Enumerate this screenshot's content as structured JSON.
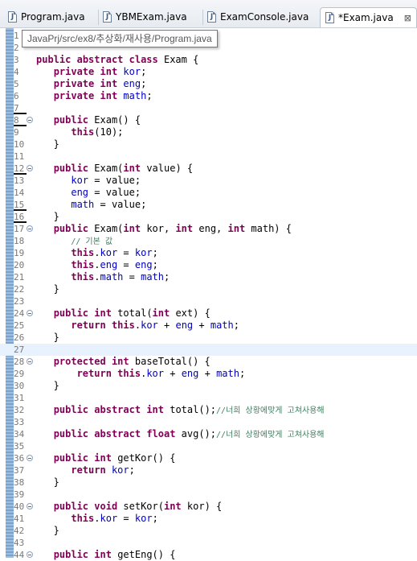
{
  "tabs": [
    {
      "label": "Program.java",
      "icon": "java-file-icon",
      "active": false
    },
    {
      "label": "YBMExam.java",
      "icon": "java-file-icon",
      "active": false
    },
    {
      "label": "ExamConsole.java",
      "icon": "java-file-icon",
      "active": false
    },
    {
      "label": "*Exam.java",
      "icon": "java-file-icon",
      "active": true,
      "close": "⊠"
    }
  ],
  "tooltip": {
    "text": "JavaPrj/src/ex8/추상화/재사용/Program.java"
  },
  "editor": {
    "current_line": 27,
    "lines": [
      {
        "n": "1",
        "t": ""
      },
      {
        "n": "2",
        "t": ""
      },
      {
        "n": "3",
        "t": "public abstract class Exam {"
      },
      {
        "n": "4",
        "t": "   private int kor;"
      },
      {
        "n": "5",
        "t": "   private int eng;"
      },
      {
        "n": "6",
        "t": "   private int math;"
      },
      {
        "n": "7",
        "t": "",
        "mark": true
      },
      {
        "n": "8",
        "t": "   public Exam() {",
        "fold": true,
        "mark": true
      },
      {
        "n": "9",
        "t": "      this(10);"
      },
      {
        "n": "10",
        "t": "   }"
      },
      {
        "n": "11",
        "t": ""
      },
      {
        "n": "12",
        "t": "   public Exam(int value) {",
        "fold": true,
        "mark": true
      },
      {
        "n": "13",
        "t": "      kor = value;"
      },
      {
        "n": "14",
        "t": "      eng = value;"
      },
      {
        "n": "15",
        "t": "      math = value;",
        "mark": true
      },
      {
        "n": "16",
        "t": "   }",
        "mark": true
      },
      {
        "n": "17",
        "t": "   public Exam(int kor, int eng, int math) {",
        "fold": true
      },
      {
        "n": "18",
        "t": "      // 기본 값"
      },
      {
        "n": "19",
        "t": "      this.kor = kor;"
      },
      {
        "n": "20",
        "t": "      this.eng = eng;"
      },
      {
        "n": "21",
        "t": "      this.math = math;"
      },
      {
        "n": "22",
        "t": "   }"
      },
      {
        "n": "23",
        "t": ""
      },
      {
        "n": "24",
        "t": "   public int total(int ext) {",
        "fold": true
      },
      {
        "n": "25",
        "t": "      return this.kor + eng + math;"
      },
      {
        "n": "26",
        "t": "   }"
      },
      {
        "n": "27",
        "t": ""
      },
      {
        "n": "28",
        "t": "   protected int baseTotal() {",
        "fold": true
      },
      {
        "n": "29",
        "t": "       return this.kor + eng + math;"
      },
      {
        "n": "30",
        "t": "   }"
      },
      {
        "n": "31",
        "t": ""
      },
      {
        "n": "32",
        "t": "   public abstract int total();//너희 상황에맞게 고쳐사용해"
      },
      {
        "n": "33",
        "t": ""
      },
      {
        "n": "34",
        "t": "   public abstract float avg();//너희 상황에맞게 고쳐사용해"
      },
      {
        "n": "35",
        "t": ""
      },
      {
        "n": "36",
        "t": "   public int getKor() {",
        "fold": true
      },
      {
        "n": "37",
        "t": "      return kor;"
      },
      {
        "n": "38",
        "t": "   }"
      },
      {
        "n": "39",
        "t": ""
      },
      {
        "n": "40",
        "t": "   public void setKor(int kor) {",
        "fold": true
      },
      {
        "n": "41",
        "t": "      this.kor = kor;"
      },
      {
        "n": "42",
        "t": "   }"
      },
      {
        "n": "43",
        "t": ""
      },
      {
        "n": "44",
        "t": "   public int getEng() {",
        "fold": true
      }
    ]
  }
}
